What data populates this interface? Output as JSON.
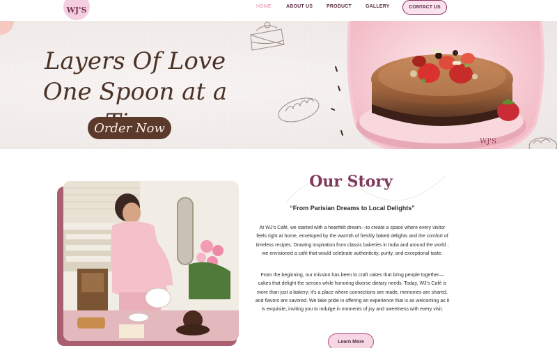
{
  "brand": {
    "logo_text": "WJ'S"
  },
  "nav": {
    "items": [
      {
        "label": "HOME",
        "active": true
      },
      {
        "label": "ABOUT US",
        "active": false
      },
      {
        "label": "PRODUCT",
        "active": false
      },
      {
        "label": "GALLERY",
        "active": false
      }
    ],
    "contact_label": "CONTACT US"
  },
  "hero": {
    "title_line1": "Layers Of Love",
    "title_line2": "One Spoon at a Time",
    "cta_label": "Order Now",
    "cake_board_text": "WJ'S"
  },
  "story": {
    "title": "Our Story",
    "subtitle": "“From Parisian Dreams to Local Delights”",
    "paragraph1": "At WJ’s Café, we started with a heartfelt dream—to create a space where every visitor feels right at home, enveloped by the warmth of freshly baked delights and the comfort of timeless recipes. Drawing inspiration from classic bakeries in India and around the world , we envisioned a café that would celebrate authenticity, purity, and exceptional taste.",
    "paragraph2": "From the beginning, our mission has been to craft cakes that bring people together—cakes that delight the senses while honoring diverse dietary needs. Today, WJ’s Café is more than just a bakery; it’s a place where connections are made, memories are shared, and flavors are savored. We take pride in offering an experience that is as welcoming as it is exquisite, inviting you to indulge in moments of joy and sweetness with every visit.",
    "cta_label": "Learn More"
  },
  "colors": {
    "accent_pink": "#f4cfe0",
    "brand_plum": "#7d3a5a",
    "hero_button": "#5b3a2b",
    "active_nav": "#e58aa8"
  }
}
